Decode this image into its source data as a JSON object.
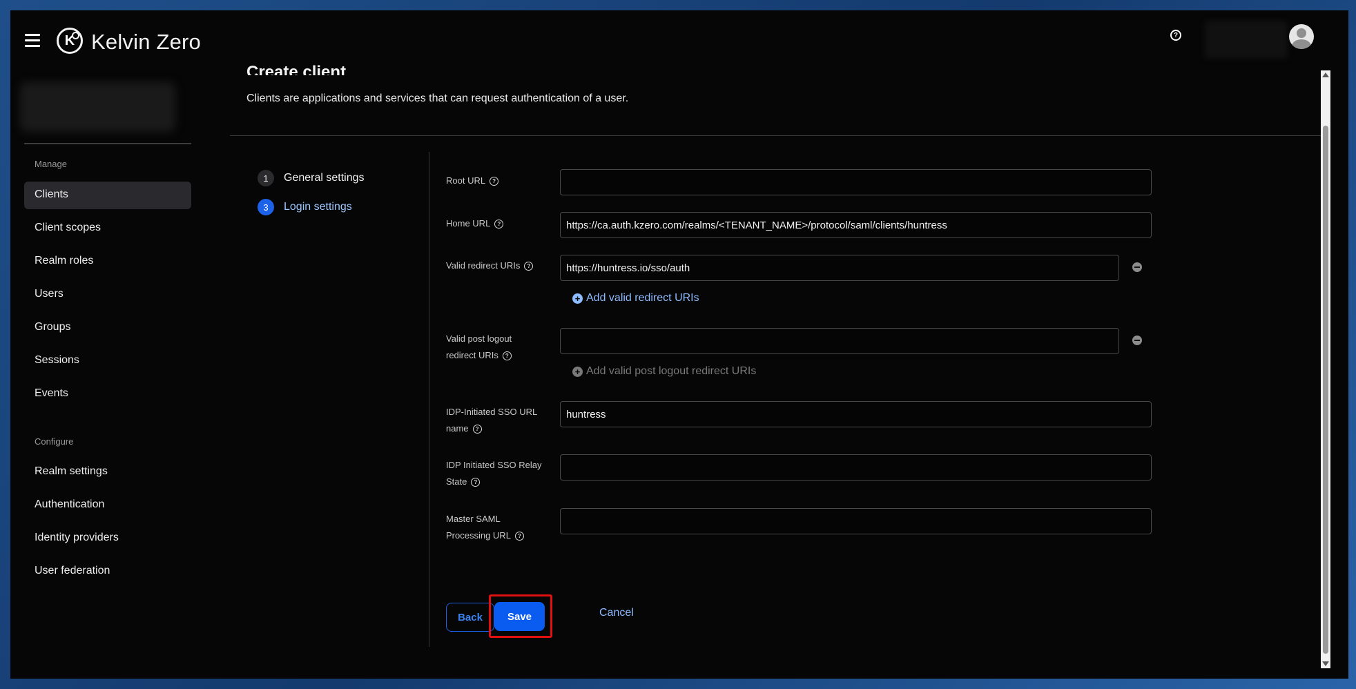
{
  "header": {
    "brand": "Kelvin Zero",
    "logo_letter": "K"
  },
  "sidebar": {
    "manage_label": "Manage",
    "manage_items": [
      {
        "label": "Clients",
        "active": true
      },
      {
        "label": "Client scopes"
      },
      {
        "label": "Realm roles"
      },
      {
        "label": "Users"
      },
      {
        "label": "Groups"
      },
      {
        "label": "Sessions"
      },
      {
        "label": "Events"
      }
    ],
    "configure_label": "Configure",
    "configure_items": [
      {
        "label": "Realm settings"
      },
      {
        "label": "Authentication"
      },
      {
        "label": "Identity providers"
      },
      {
        "label": "User federation"
      }
    ]
  },
  "page": {
    "title": "Create client",
    "description": "Clients are applications and services that can request authentication of a user."
  },
  "steps": [
    {
      "number": "1",
      "label": "General settings",
      "active": false
    },
    {
      "number": "3",
      "label": "Login settings",
      "active": true
    }
  ],
  "form": {
    "root_url": {
      "label": "Root URL",
      "value": ""
    },
    "home_url": {
      "label": "Home URL",
      "value": "https://ca.auth.kzero.com/realms/<TENANT_NAME>/protocol/saml/clients/huntress"
    },
    "valid_redirect": {
      "label": "Valid redirect URIs",
      "value": "https://huntress.io/sso/auth",
      "add_label": "Add valid redirect URIs"
    },
    "post_logout": {
      "label_line1": "Valid post logout",
      "label_line2": "redirect URIs",
      "value": "",
      "add_label": "Add valid post logout redirect URIs"
    },
    "idp_sso_url_name": {
      "label_line1": "IDP-Initiated SSO URL",
      "label_line2": "name",
      "value": "huntress"
    },
    "idp_relay_state": {
      "label_line1": "IDP Initiated SSO Relay",
      "label_line2": "State",
      "value": ""
    },
    "master_saml": {
      "label_line1": "Master SAML",
      "label_line2": "Processing URL",
      "value": ""
    }
  },
  "actions": {
    "back": "Back",
    "save": "Save",
    "cancel": "Cancel"
  },
  "icons": {
    "help": "?",
    "plus": "+"
  },
  "colors": {
    "accent": "#0a5cf0",
    "link": "#8cbcff",
    "highlight": "#e01010"
  }
}
